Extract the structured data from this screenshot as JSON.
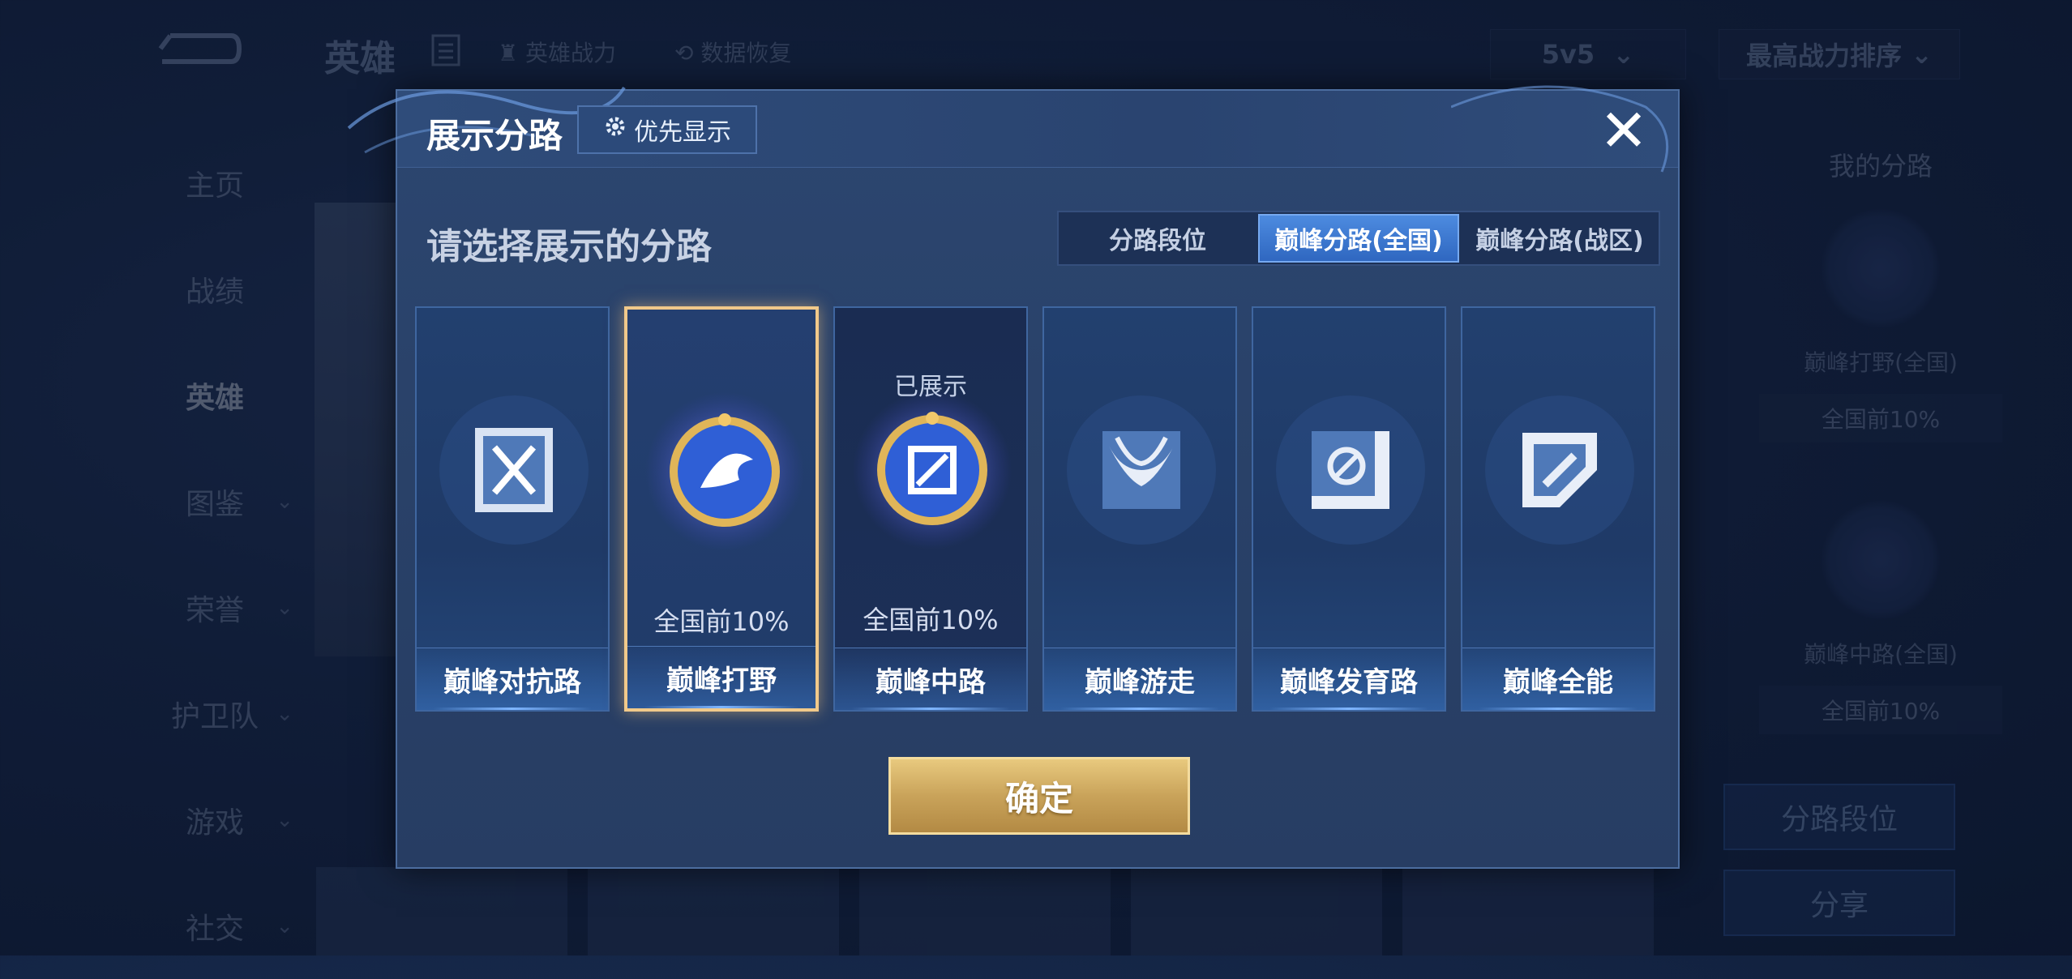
{
  "background": {
    "header": {
      "title": "英雄",
      "hero_power_label": "英雄战力",
      "data_restore_label": "数据恢复",
      "mode_select": "5v5",
      "sort_select": "最高战力排序"
    },
    "sidebar": {
      "items": [
        {
          "label": "主页"
        },
        {
          "label": "战绩"
        },
        {
          "label": "英雄"
        },
        {
          "label": "图鉴"
        },
        {
          "label": "荣誉"
        },
        {
          "label": "护卫队"
        },
        {
          "label": "游戏"
        },
        {
          "label": "社交"
        }
      ]
    },
    "my_lanes": {
      "title": "我的分路",
      "entries": [
        {
          "label": "巅峰打野(全国)",
          "pct": "全国前10%"
        },
        {
          "label": "巅峰中路(全国)",
          "pct": "全国前10%"
        }
      ],
      "lane_rank_button": "分路段位",
      "share_button": "分享"
    }
  },
  "modal": {
    "title": "展示分路",
    "priority_button": "优先显示",
    "subtitle": "请选择展示的分路",
    "tabs": [
      {
        "label": "分路段位",
        "active": false
      },
      {
        "label": "巅峰分路(全国)",
        "active": true
      },
      {
        "label": "巅峰分路(战区)",
        "active": false
      }
    ],
    "cards": [
      {
        "name": "巅峰对抗路",
        "pct": "",
        "status": "",
        "icon": "clash-lane-icon"
      },
      {
        "name": "巅峰打野",
        "pct": "全国前10%",
        "status": "",
        "icon": "jungle-dragon-icon",
        "selected": true
      },
      {
        "name": "巅峰中路",
        "pct": "全国前10%",
        "status": "已展示",
        "icon": "mid-lane-icon"
      },
      {
        "name": "巅峰游走",
        "pct": "",
        "status": "",
        "icon": "roam-wings-icon"
      },
      {
        "name": "巅峰发育路",
        "pct": "",
        "status": "",
        "icon": "farm-lane-icon"
      },
      {
        "name": "巅峰全能",
        "pct": "",
        "status": "",
        "icon": "all-round-icon"
      }
    ],
    "confirm_button": "确定"
  }
}
